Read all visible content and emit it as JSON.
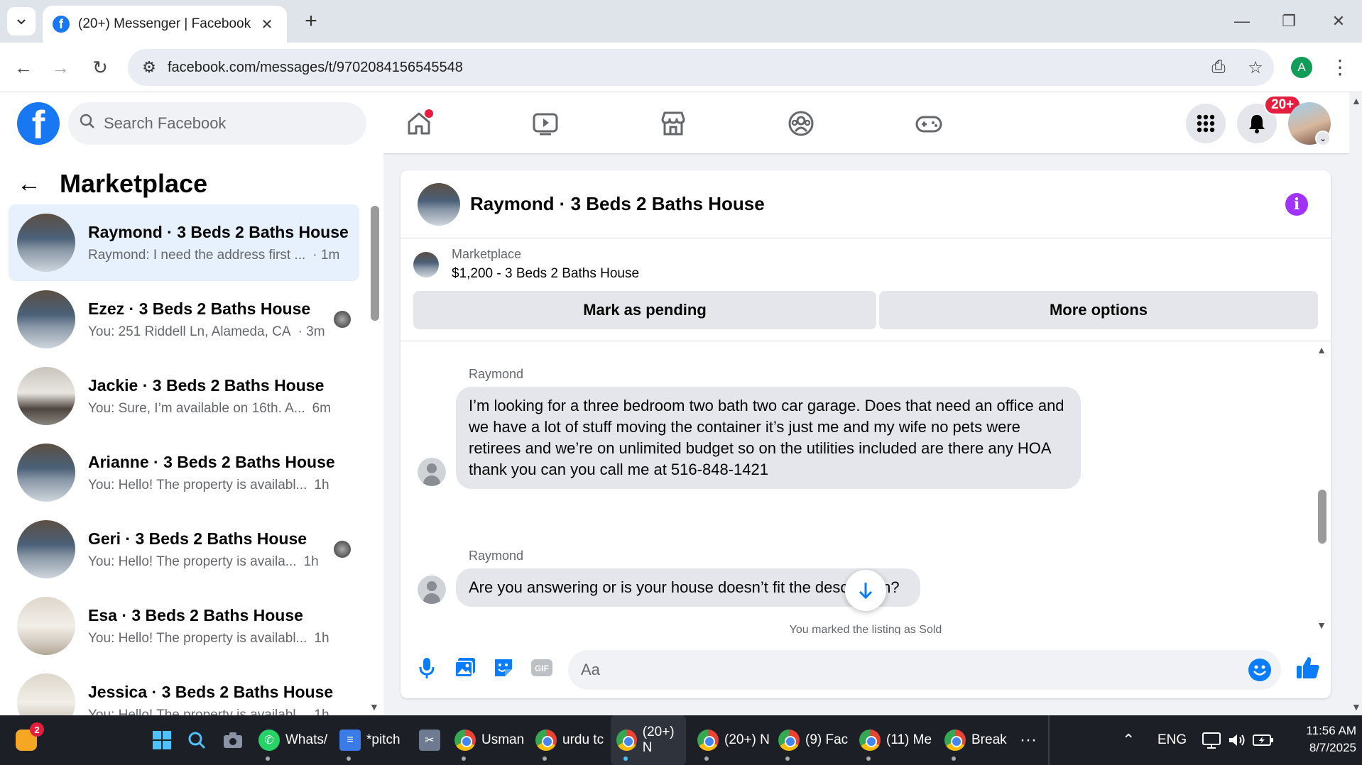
{
  "browser": {
    "tab_title": "(20+) Messenger | Facebook",
    "url": "facebook.com/messages/t/9702084156545548",
    "profile_initial": "A"
  },
  "fb": {
    "search_placeholder": "Search Facebook",
    "notifications_badge": "20+",
    "accent_color": "#1877f2"
  },
  "left_panel": {
    "title": "Marketplace",
    "conversations": [
      {
        "name": "Raymond · 3 Beds 2 Baths House",
        "preview": "Raymond: I need the address first ...",
        "time": "· 1m"
      },
      {
        "name": "Ezez · 3 Beds 2 Baths House",
        "preview": "You: 251 Riddell Ln, Alameda, CA",
        "time": "· 3m"
      },
      {
        "name": "Jackie · 3 Beds 2 Baths House",
        "preview": "You: Sure, I’m available on 16th. A...",
        "time": "6m"
      },
      {
        "name": "Arianne · 3 Beds 2 Baths House",
        "preview": "You: Hello! The property is availabl...",
        "time": "1h"
      },
      {
        "name": "Geri · 3 Beds 2 Baths House",
        "preview": "You: Hello! The property is availa...",
        "time": "1h"
      },
      {
        "name": "Esa · 3 Beds 2 Baths House",
        "preview": "You: Hello! The property is availabl...",
        "time": "1h"
      },
      {
        "name": "Jessica · 3 Beds 2 Baths House",
        "preview": "You: Hello! The property is availabl...",
        "time": "1h"
      }
    ]
  },
  "chat": {
    "title": "Raymond · 3 Beds 2 Baths House",
    "listing_source": "Marketplace",
    "listing_title": "$1,200 - 3 Beds 2 Baths House",
    "mark_pending_label": "Mark as pending",
    "more_options_label": "More options",
    "messages": [
      {
        "sender": "Raymond",
        "text": "I’m looking for a three bedroom two bath two car garage. Does that need an office and we have a lot of stuff moving the container it’s just me and my wife no pets were retirees and we’re on unlimited budget so on the utilities included are there any HOA thank you can you call me at 516-848-1421"
      },
      {
        "sender": "Raymond",
        "text": "Are you answering or is your house doesn’t fit the description?"
      }
    ],
    "system_note": "You marked the listing as Sold",
    "composer_placeholder": "Aa"
  },
  "taskbar": {
    "notification_count": "2",
    "items": [
      {
        "label": "Whats/",
        "icon": "whatsapp-icon"
      },
      {
        "label": "*pitch",
        "icon": "notepad-icon"
      },
      {
        "label": "Usman",
        "icon": "chrome-icon"
      },
      {
        "label": "urdu tc",
        "icon": "chrome-icon"
      },
      {
        "label": "(20+) N",
        "icon": "chrome-icon"
      },
      {
        "label": "(20+) N",
        "icon": "chrome-icon"
      },
      {
        "label": "(9) Fac",
        "icon": "chrome-icon"
      },
      {
        "label": "(11) Me",
        "icon": "chrome-icon"
      },
      {
        "label": "Break",
        "icon": "chrome-icon"
      }
    ],
    "language": "ENG",
    "time": "11:56 AM",
    "date": "8/7/2025"
  }
}
